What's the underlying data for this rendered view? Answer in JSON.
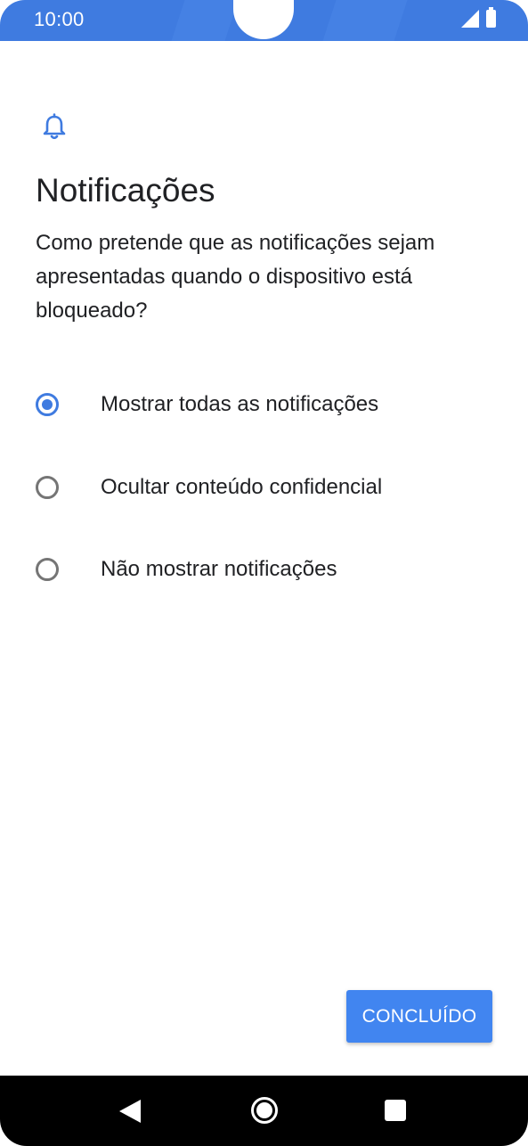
{
  "status_bar": {
    "time": "10:00",
    "icons": [
      "signal-icon",
      "battery-icon"
    ],
    "color": "#3f7be0"
  },
  "header": {
    "icon": "bell-icon",
    "title": "Notificações",
    "description": "Como pretende que as notificações sejam apresentadas quando o dispositivo está bloqueado?"
  },
  "options": [
    {
      "label": "Mostrar todas as notificações",
      "selected": true
    },
    {
      "label": "Ocultar conteúdo confidencial",
      "selected": false
    },
    {
      "label": "Não mostrar notificações",
      "selected": false
    }
  ],
  "actions": {
    "done_label": "CONCLUÍDO"
  },
  "nav_bar": {
    "icons": [
      "back-icon",
      "home-icon",
      "recents-icon"
    ]
  },
  "colors": {
    "accent": "#3f7be0",
    "button": "#4185f0",
    "radio_unselected": "#757575",
    "text": "#202124"
  }
}
